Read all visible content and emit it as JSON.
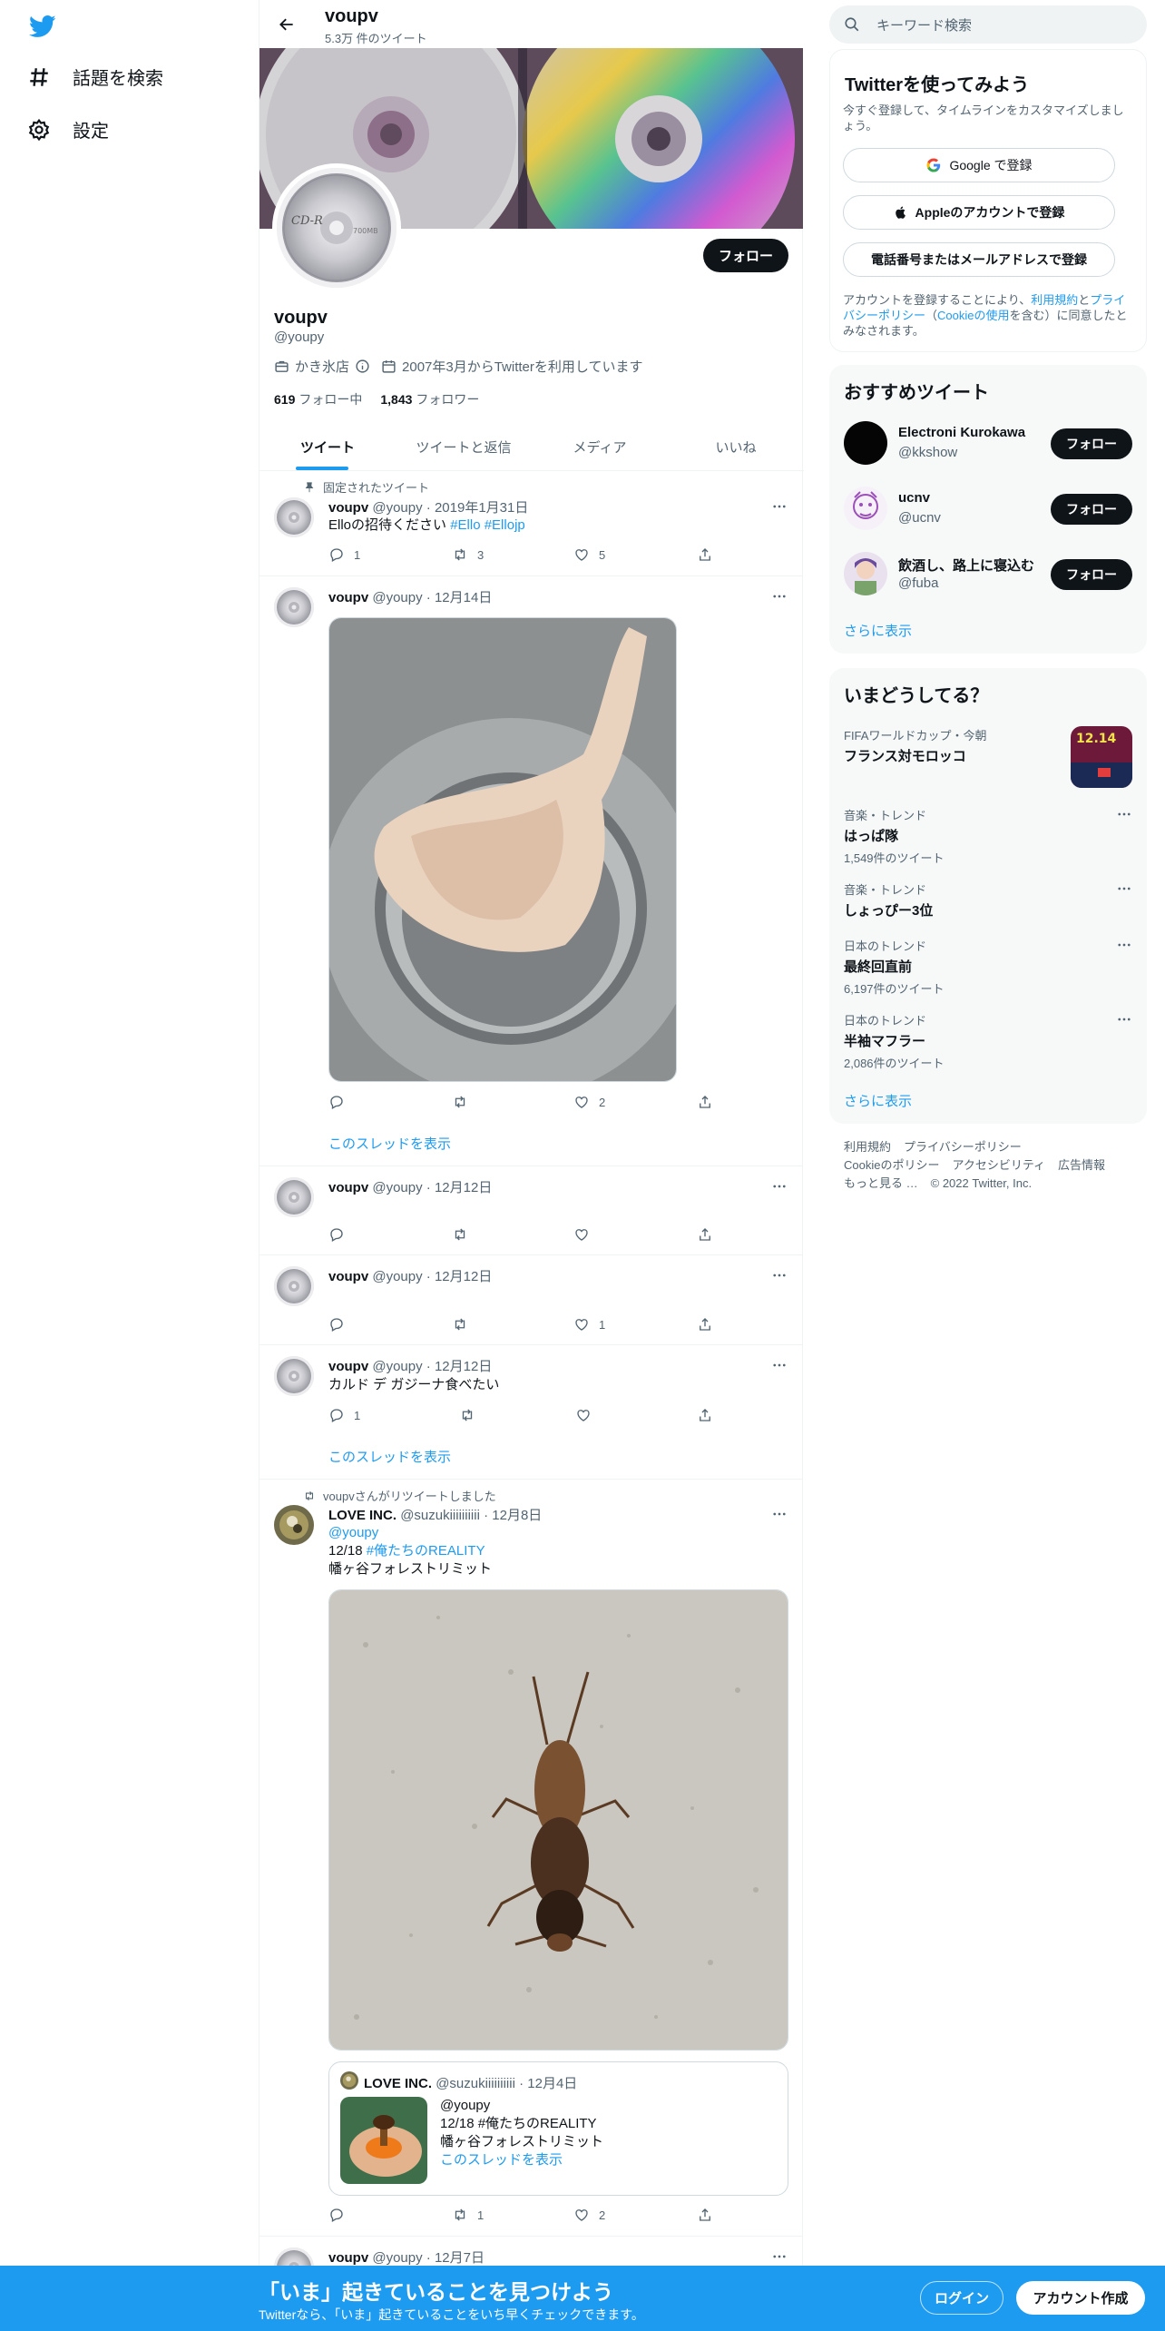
{
  "nav": {
    "items": [
      {
        "label": "話題を検索",
        "icon": "hashtag-icon"
      },
      {
        "label": "設定",
        "icon": "gear-icon"
      }
    ]
  },
  "header": {
    "name": "voupv",
    "tweet_count": "5.3万 件のツイート"
  },
  "profile": {
    "follow_label": "フォロー",
    "name": "voupv",
    "handle": "@youpy",
    "category": "かき氷店",
    "joined": "2007年3月からTwitterを利用しています",
    "following_count": "619",
    "following_label": "フォロー中",
    "followers_count": "1,843",
    "followers_label": "フォロワー"
  },
  "tabs": [
    {
      "label": "ツイート",
      "active": true
    },
    {
      "label": "ツイートと返信",
      "active": false
    },
    {
      "label": "メディア",
      "active": false
    },
    {
      "label": "いいね",
      "active": false
    }
  ],
  "tweets": [
    {
      "context": "固定されたツイート",
      "name": "voupv",
      "handle": "@youpy",
      "date": "2019年1月31日",
      "text_plain": "Elloの招待ください ",
      "text_tags": "#Ello #Ellojp",
      "replies": "1",
      "retweets": "3",
      "likes": "5"
    },
    {
      "name": "voupv",
      "handle": "@youpy",
      "date": "12月14日",
      "replies": "",
      "retweets": "",
      "likes": "2",
      "show_thread": "このスレッドを表示"
    },
    {
      "name": "voupv",
      "handle": "@youpy",
      "date": "12月12日",
      "replies": "",
      "retweets": "",
      "likes": ""
    },
    {
      "name": "voupv",
      "handle": "@youpy",
      "date": "12月12日",
      "replies": "",
      "retweets": "",
      "likes": "1"
    },
    {
      "name": "voupv",
      "handle": "@youpy",
      "date": "12月12日",
      "text": "カルド デ ガジーナ食べたい",
      "replies": "1",
      "retweets": "",
      "likes": "",
      "show_thread": "このスレッドを表示"
    },
    {
      "context": "voupvさんがリツイートしました",
      "name": "LOVE INC.",
      "handle": "@suzukiiiiiiiiii",
      "date": "12月8日",
      "mention": "@youpy",
      "line1_plain": "12/18 ",
      "line1_tag": "#俺たちのREALITY",
      "line2": "幡ヶ谷フォレストリミット",
      "replies": "",
      "retweets": "1",
      "likes": "2",
      "quote": {
        "name": "LOVE INC.",
        "handle": "@suzukiiiiiiiiii",
        "date": "12月4日",
        "line1": "@youpy",
        "line2": "12/18 #俺たちのREALITY",
        "line3": "幡ヶ谷フォレストリミット",
        "show_thread": "このスレッドを表示"
      }
    },
    {
      "name": "voupv",
      "handle": "@youpy",
      "date": "12月7日"
    }
  ],
  "search": {
    "placeholder": "キーワード検索"
  },
  "signup": {
    "title": "Twitterを使ってみよう",
    "subtitle": "今すぐ登録して、タイムラインをカスタマイズしましょう。",
    "google": "Google で登録",
    "apple": "Appleのアカウントで登録",
    "phone": "電話番号またはメールアドレスで登録",
    "legal_a": "アカウントを登録することにより、",
    "legal_terms": "利用規約",
    "legal_b": "と",
    "legal_privacy": "プライバシーポリシー",
    "legal_c": "（",
    "legal_cookie": "Cookieの使用",
    "legal_d": "を含む）に同意したとみなされます。"
  },
  "recommended": {
    "title": "おすすめツイート",
    "users": [
      {
        "name": "Electroni Kurokawa",
        "handle": "@kkshow",
        "follow": "フォロー"
      },
      {
        "name": "ucnv",
        "handle": "@ucnv",
        "follow": "フォロー"
      },
      {
        "name": "飲酒し、路上に寝込む",
        "handle": "@fuba",
        "follow": "フォロー"
      }
    ],
    "more": "さらに表示"
  },
  "trends": {
    "title": "いまどうしてる？",
    "items": [
      {
        "context": "FIFAワールドカップ・今朝",
        "name": "フランス対モロッコ",
        "count": ""
      },
      {
        "context": "音楽・トレンド",
        "name": "はっぱ隊",
        "count": "1,549件のツイート"
      },
      {
        "context": "音楽・トレンド",
        "name": "しょっぴー3位",
        "count": ""
      },
      {
        "context": "日本のトレンド",
        "name": "最終回直前",
        "count": "6,197件のツイート"
      },
      {
        "context": "日本のトレンド",
        "name": "半袖マフラー",
        "count": "2,086件のツイート"
      }
    ],
    "thumb_text": "12.14",
    "more": "さらに表示"
  },
  "footer": {
    "links": [
      "利用規約",
      "プライバシーポリシー",
      "Cookieのポリシー",
      "アクセシビリティ",
      "広告情報",
      "もっと見る …"
    ],
    "copyright": "© 2022 Twitter, Inc."
  },
  "bottombar": {
    "title": "「いま」起きていることを見つけよう",
    "subtitle": "Twitterなら、「いま」起きていることをいち早くチェックできます。",
    "login": "ログイン",
    "signup": "アカウント作成"
  }
}
